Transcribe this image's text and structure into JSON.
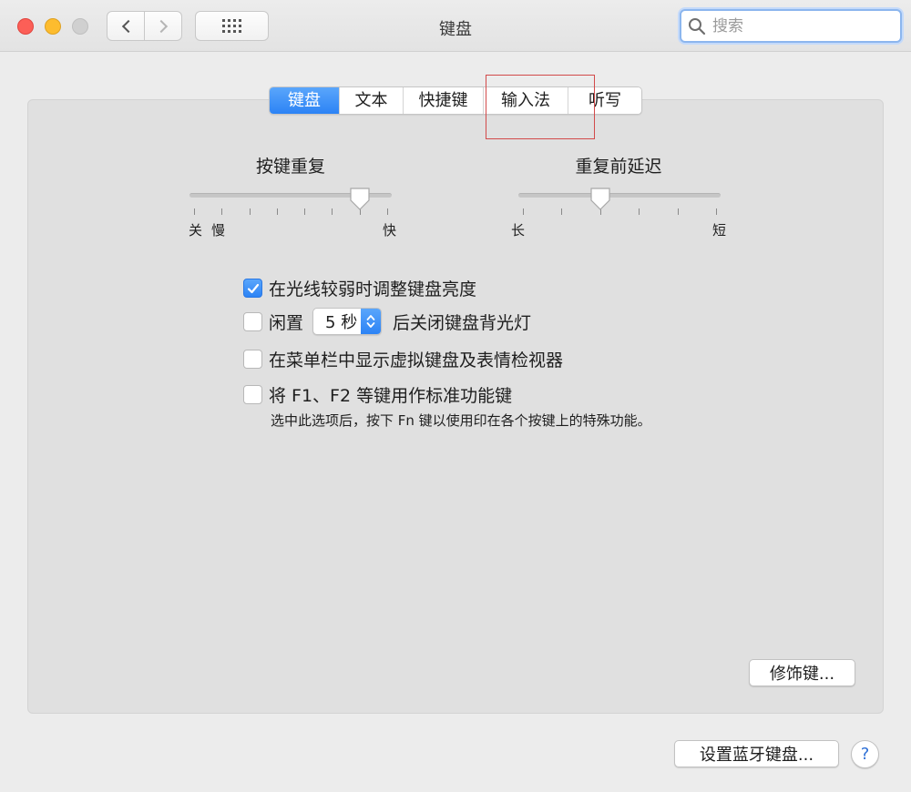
{
  "window": {
    "title": "键盘",
    "search_placeholder": "搜索"
  },
  "icons": {
    "back": "chevron-left-icon",
    "forward": "chevron-right-icon",
    "grid": "grid-icon",
    "search": "magnifier-icon"
  },
  "tabs": [
    {
      "label": "键盘",
      "active": true
    },
    {
      "label": "文本",
      "active": false
    },
    {
      "label": "快捷键",
      "active": false
    },
    {
      "label": "输入法",
      "active": false
    },
    {
      "label": "听写",
      "active": false
    }
  ],
  "key_repeat": {
    "title": "按键重复",
    "label_off": "关",
    "label_slow": "慢",
    "label_fast": "快",
    "ticks": 8,
    "value_step": 6
  },
  "delay_until_repeat": {
    "title": "重复前延迟",
    "label_long": "长",
    "label_short": "短",
    "ticks": 6,
    "value_step": 2
  },
  "options": {
    "adjust_brightness": {
      "label": "在光线较弱时调整键盘亮度",
      "checked": true
    },
    "backlight_off": {
      "prefix": "闲置",
      "popup_value": "5 秒",
      "suffix": "后关闭键盘背光灯",
      "checked": false
    },
    "show_viewer": {
      "label": "在菜单栏中显示虚拟键盘及表情检视器",
      "checked": false
    },
    "fn_keys": {
      "label": "将 F1、F2 等键用作标准功能键",
      "hint": "选中此选项后，按下 Fn 键以使用印在各个按键上的特殊功能。",
      "checked": false
    }
  },
  "buttons": {
    "modifier_keys": "修饰键...",
    "bluetooth": "设置蓝牙键盘...",
    "help": "?"
  },
  "colors": {
    "accent": "#2c83f5",
    "highlight_box": "#d24a4a"
  }
}
